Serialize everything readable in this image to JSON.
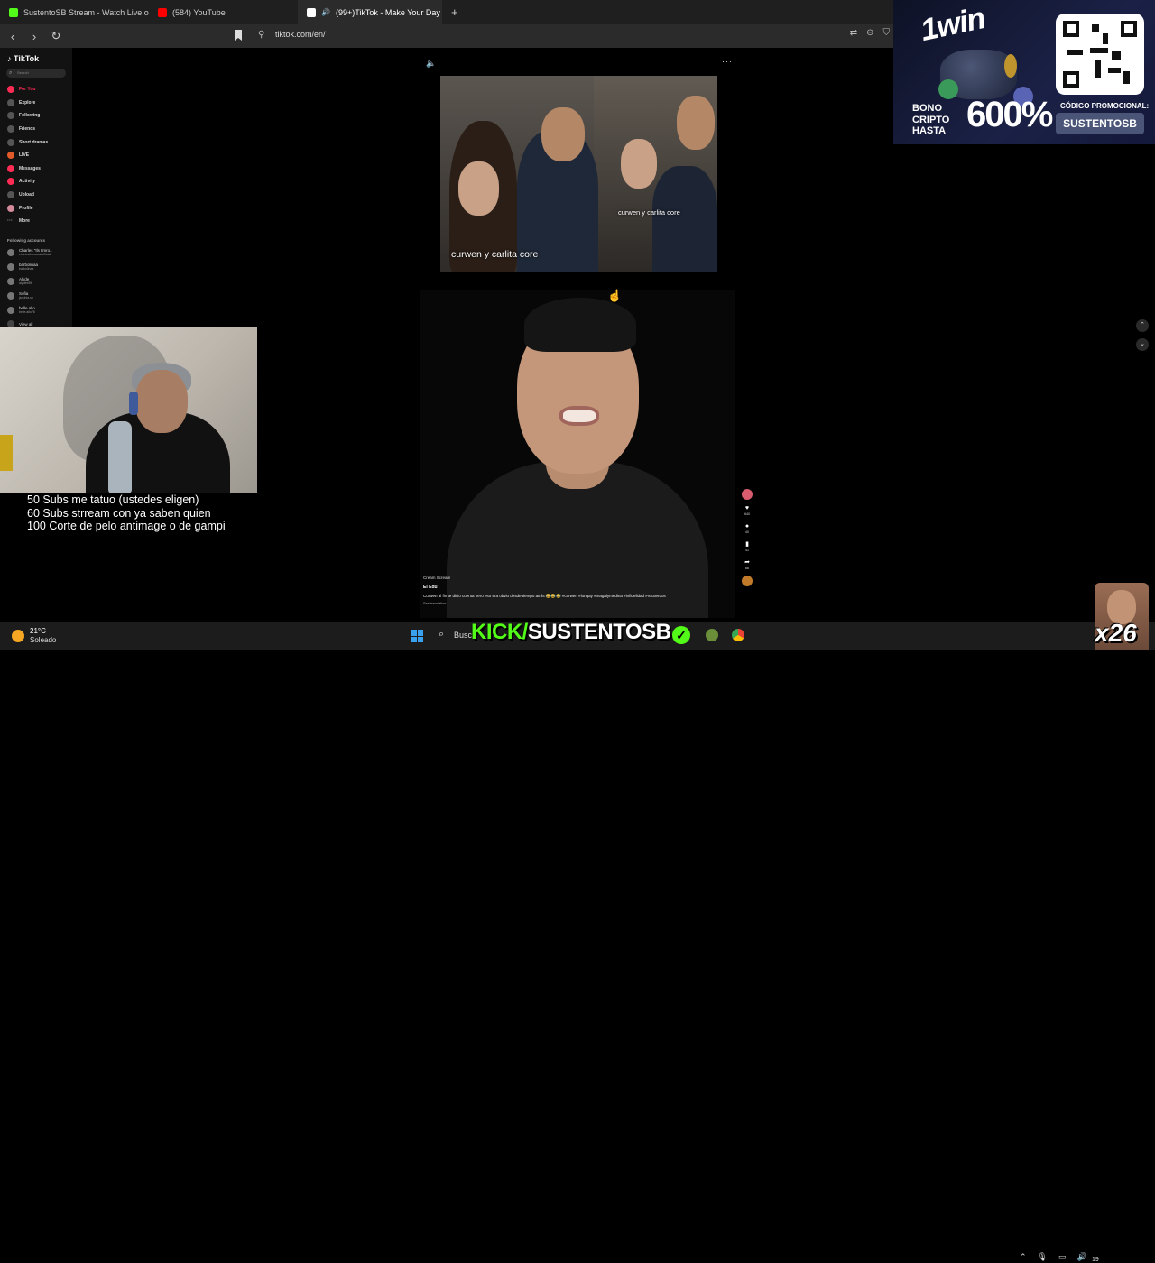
{
  "browser": {
    "tabs": [
      {
        "label": "SustentoSB Stream - Watch Live on K",
        "color": "#53fc18"
      },
      {
        "label": "(584) YouTube",
        "color": "#ff0000"
      },
      {
        "label": "(99+)TikTok - Make Your Day",
        "color": "#ffffff",
        "active": true
      }
    ],
    "new_tab": "+",
    "close": "×",
    "url": "tiktok.com/en/"
  },
  "tiktok": {
    "logo": "TikTok",
    "search_placeholder": "Search",
    "nav": [
      {
        "label": "For You",
        "active": true
      },
      {
        "label": "Explore"
      },
      {
        "label": "Following"
      },
      {
        "label": "Friends"
      },
      {
        "label": "Short dramas"
      },
      {
        "label": "LIVE"
      },
      {
        "label": "Messages"
      },
      {
        "label": "Activity"
      },
      {
        "label": "Upload"
      },
      {
        "label": "Profile"
      },
      {
        "label": "More"
      }
    ],
    "following_title": "Following accounts",
    "accounts": [
      {
        "name": "Charles \"Ils Ilmro..",
        "handle": "charlesilmrosostofficial"
      },
      {
        "name": "barbolinaa",
        "handle": "barbolinaa"
      },
      {
        "name": "Alyde",
        "handle": "alydee89"
      },
      {
        "name": "Sofia",
        "handle": "jsophia.sb"
      },
      {
        "name": "belle allo",
        "handle": "belle.allo76"
      }
    ],
    "view_all": "View all"
  },
  "video1": {
    "caption_main": "curwen y carlita core",
    "caption_small": "curwen y carlita core"
  },
  "video2": {
    "tag": "Cream Scream",
    "author": "El Edu",
    "description": "Curwen al fin te dicio cuenta pero eso era obvio desde tiempo atrás 😂😂😂 #curwen #longay #magalymedina #infidelidad #recuerdos",
    "translation": "See translation",
    "counts": {
      "likes": "640",
      "comments": "40",
      "saves": "41",
      "shares": "66"
    }
  },
  "stream": {
    "goals": [
      "50 Subs me tatuo (ustedes eligen)",
      "60 Subs strream con ya saben quien",
      "100 Corte de pelo antimage o de gampi"
    ],
    "kick_prefix": "KICK/",
    "kick_channel": "SUSTENTOSB",
    "emote_multiplier": "x26"
  },
  "sponsor": {
    "brand": "1win",
    "bono_lines": [
      "BONO",
      "CRIPTO",
      "HASTA"
    ],
    "percent": "600%",
    "code_label": "CÓDIGO PROMOCIONAL:",
    "code": "SUSTENTOSB"
  },
  "taskbar": {
    "temperature": "21°C",
    "condition": "Soleado",
    "search": "Busc",
    "clock": "19"
  },
  "colors": {
    "tiktok_red": "#fe2c55",
    "kick_green": "#53fc18"
  }
}
